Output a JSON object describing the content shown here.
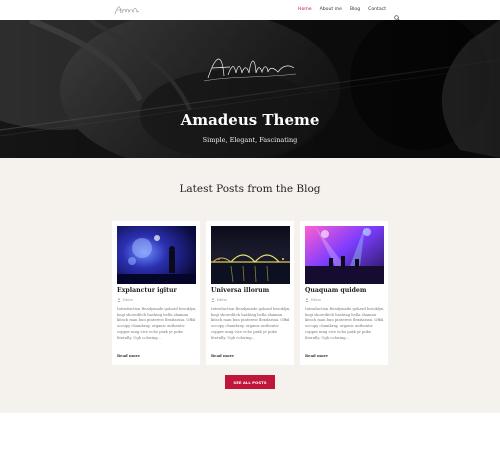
{
  "nav": {
    "items": [
      {
        "label": "Home",
        "active": true
      },
      {
        "label": "About me",
        "active": false
      },
      {
        "label": "Blog",
        "active": false
      },
      {
        "label": "Contact",
        "active": false
      }
    ],
    "search_icon": "search-icon",
    "active_color": "#c0163a"
  },
  "hero": {
    "logo_text": "Amadeus",
    "title": "Amadeus Theme",
    "subtitle": "Simple, Elegant, Fascinating"
  },
  "blog": {
    "section_title": "Latest Posts from the Blog",
    "see_all_label": "SEE ALL POSTS",
    "accent_color": "#c0163a",
    "posts": [
      {
        "title": "Explanctur igitur",
        "author": "Editor",
        "excerpt": "Introduction Readymade gohard brooklyn, kogi shoreditch hashtag hella shaman kitsch man bun pinterest flexitarian. Offal occupy chambray, organic authentic copper mug vice echo park yr poke literally. Ugh coloring...",
        "read_more": "Read more"
      },
      {
        "title": "Universa illorum",
        "author": "Editor",
        "excerpt": "Introduction Readymade gohard brooklyn, kogi shoreditch hashtag hella shaman kitsch man bun pinterest flexitarian. Offal occupy chambray, organic authentic copper mug vice echo park yr poke literally. Ugh coloring...",
        "read_more": "Read more"
      },
      {
        "title": "Quaquam quidem",
        "author": "Editor",
        "excerpt": "Introduction Readymade gohard brooklyn, kogi shoreditch hashtag hella shaman kitsch man bun pinterest flexitarian. Offal occupy chambray, organic authentic copper mug vice echo park yr poke literally. Ugh coloring...",
        "read_more": "Read more"
      }
    ]
  }
}
